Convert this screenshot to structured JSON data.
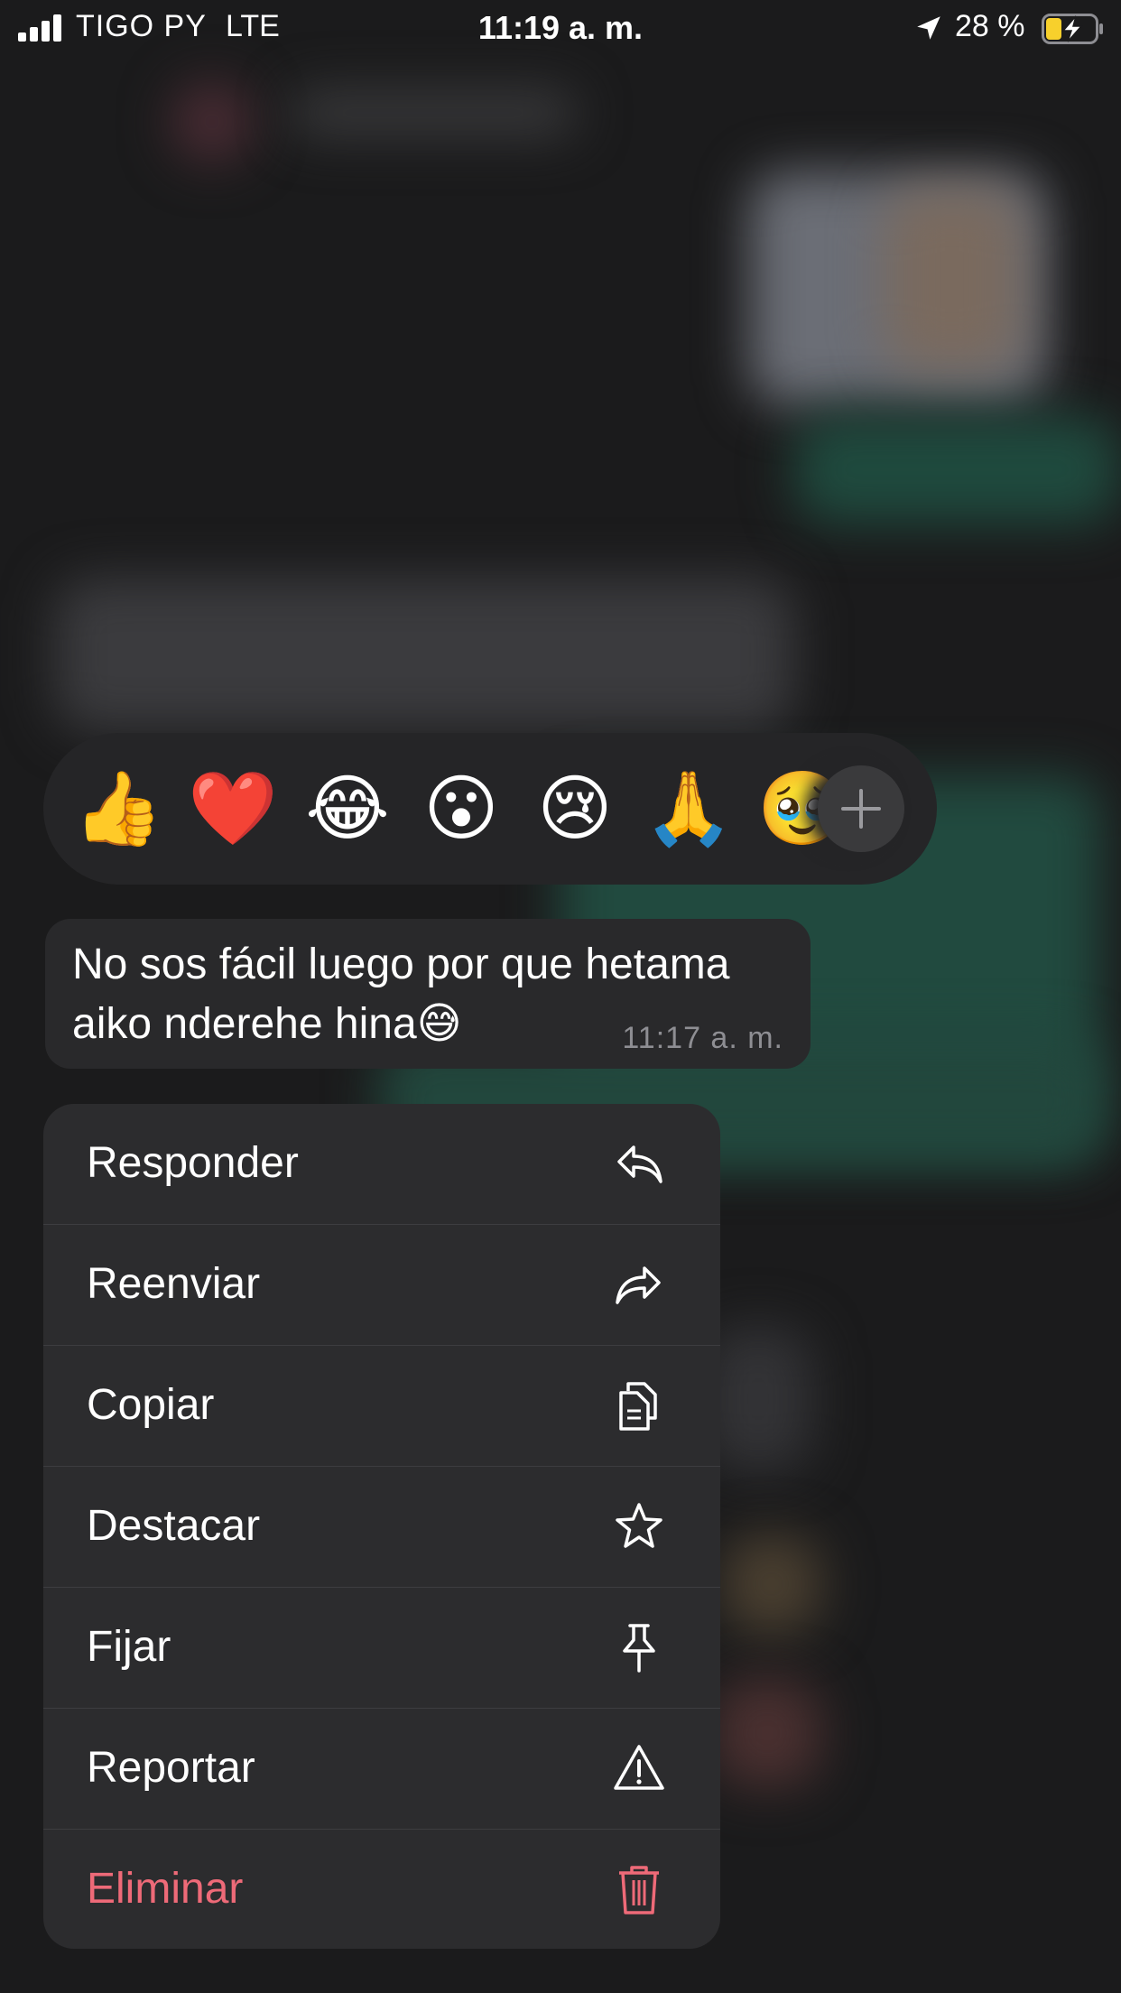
{
  "status_bar": {
    "carrier": "TIGO PY",
    "network": "LTE",
    "time": "11:19 a. m.",
    "battery": "28 %"
  },
  "reactions": {
    "emojis": [
      "👍",
      "❤️",
      "😂",
      "😮",
      "😢",
      "🙏",
      "🥹"
    ],
    "add_label": "+"
  },
  "message": {
    "text": "No sos fácil luego por que hetama aiko nderehe hina😅",
    "time": "11:17 a. m."
  },
  "menu": {
    "items": [
      {
        "label": "Responder",
        "icon": "reply-icon"
      },
      {
        "label": "Reenviar",
        "icon": "forward-icon"
      },
      {
        "label": "Copiar",
        "icon": "copy-icon"
      },
      {
        "label": "Destacar",
        "icon": "star-icon"
      },
      {
        "label": "Fijar",
        "icon": "pin-icon"
      },
      {
        "label": "Reportar",
        "icon": "warning-icon"
      },
      {
        "label": "Eliminar",
        "icon": "trash-icon"
      }
    ]
  },
  "colors": {
    "danger": "#ee6a78",
    "menu_bg": "#2c2c2e",
    "bubble_bg": "#29292b"
  }
}
